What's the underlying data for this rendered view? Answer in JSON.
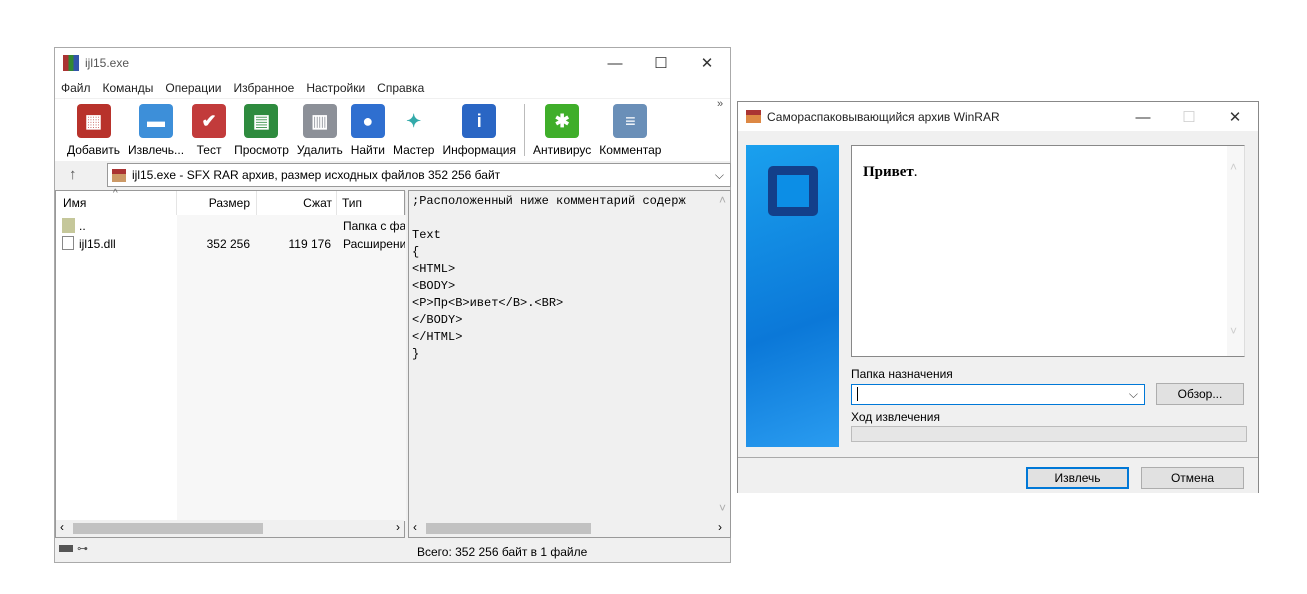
{
  "main": {
    "title": "ijl15.exe",
    "menu": [
      "Файл",
      "Команды",
      "Операции",
      "Избранное",
      "Настройки",
      "Справка"
    ],
    "toolbar": [
      {
        "label": "Добавить",
        "icon": "add-archive-icon",
        "color": "#b8322b",
        "glyph": "▦"
      },
      {
        "label": "Извлечь...",
        "icon": "extract-folder-icon",
        "color": "#3d8fd9",
        "glyph": "▬"
      },
      {
        "label": "Тест",
        "icon": "test-clipboard-icon",
        "color": "#c23b3b",
        "glyph": "✔"
      },
      {
        "label": "Просмотр",
        "icon": "view-book-icon",
        "color": "#2e8b3e",
        "glyph": "▤"
      },
      {
        "label": "Удалить",
        "icon": "delete-trash-icon",
        "color": "#8c9098",
        "glyph": "▥"
      },
      {
        "label": "Найти",
        "icon": "find-magnifier-icon",
        "color": "#2f6fd0",
        "glyph": "●"
      },
      {
        "label": "Мастер",
        "icon": "wizard-wand-icon",
        "color": "#ffffff",
        "glyph": "✦"
      },
      {
        "label": "Информация",
        "icon": "info-icon",
        "color": "#2a66c4",
        "glyph": "i"
      },
      {
        "label": "Антивирус",
        "icon": "antivirus-bug-icon",
        "color": "#3fae2a",
        "glyph": "✱"
      },
      {
        "label": "Комментар",
        "icon": "comment-icon",
        "color": "#6a8fb8",
        "glyph": "≡"
      }
    ],
    "more": "»",
    "address": "ijl15.exe - SFX RAR архив, размер исходных файлов 352 256 байт",
    "columns": {
      "name": "Имя",
      "size": "Размер",
      "packed": "Сжат",
      "type": "Тип"
    },
    "files": [
      {
        "name": "..",
        "size": "",
        "packed": "",
        "type": "Папка с фа"
      },
      {
        "name": "ijl15.dll",
        "size": "352 256",
        "packed": "119 176",
        "type": "Расширени"
      }
    ],
    "comment": ";Расположенный ниже комментарий содерж\n\nText\n{\n<HTML>\n<BODY>\n<P>Пр<B>ивет</B>.<BR>\n</BODY>\n</HTML>\n}",
    "status": "Всего: 352 256 байт в 1 файле"
  },
  "dialog": {
    "title": "Самораспаковывающийся архив WinRAR",
    "greeting_bold": "Привет",
    "greeting_tail": ".",
    "dest_label": "Папка назначения",
    "dest_value": "",
    "browse": "Обзор...",
    "progress_label": "Ход извлечения",
    "progress": 0,
    "extract": "Извлечь",
    "cancel": "Отмена"
  }
}
